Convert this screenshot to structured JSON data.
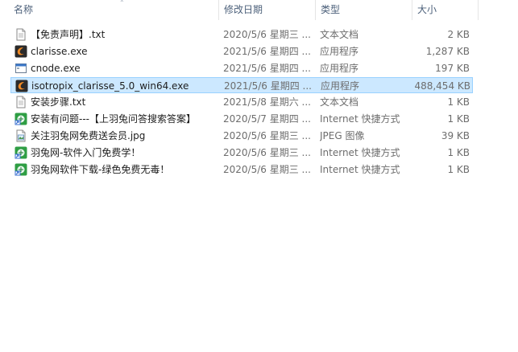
{
  "columns": {
    "name": "名称",
    "date": "修改日期",
    "type": "类型",
    "size": "大小"
  },
  "files": [
    {
      "name": "【免责声明】.txt",
      "date": "2020/5/6 星期三 ...",
      "type": "文本文档",
      "size": "2 KB",
      "icon": "text-file-icon"
    },
    {
      "name": "clarisse.exe",
      "date": "2021/5/6 星期四 ...",
      "type": "应用程序",
      "size": "1,287 KB",
      "icon": "clarisse-app-icon"
    },
    {
      "name": "cnode.exe",
      "date": "2021/5/6 星期四 ...",
      "type": "应用程序",
      "size": "197 KB",
      "icon": "exe-window-icon"
    },
    {
      "name": "isotropix_clarisse_5.0_win64.exe",
      "date": "2021/5/6 星期四 ...",
      "type": "应用程序",
      "size": "488,454 KB",
      "icon": "clarisse-app-icon",
      "selected": true
    },
    {
      "name": "安装步骤.txt",
      "date": "2021/5/8 星期六 ...",
      "type": "文本文档",
      "size": "1 KB",
      "icon": "text-file-icon"
    },
    {
      "name": "安装有问题---【上羽兔问答搜索答案】",
      "date": "2020/5/7 星期四 ...",
      "type": "Internet 快捷方式",
      "size": "1 KB",
      "icon": "internet-shortcut-icon"
    },
    {
      "name": "关注羽兔网免费送会员.jpg",
      "date": "2020/5/6 星期三 ...",
      "type": "JPEG 图像",
      "size": "39 KB",
      "icon": "image-file-icon"
    },
    {
      "name": "羽兔网-软件入门免费学！",
      "date": "2020/5/6 星期三 ...",
      "type": "Internet 快捷方式",
      "size": "1 KB",
      "icon": "internet-shortcut-icon"
    },
    {
      "name": "羽兔网软件下载-绿色免费无毒！",
      "date": "2020/5/6 星期三 ...",
      "type": "Internet 快捷方式",
      "size": "1 KB",
      "icon": "internet-shortcut-icon"
    }
  ],
  "colors": {
    "selection_fill": "#cce8ff",
    "selection_border": "#99d1ff",
    "header_text": "#4c607a"
  }
}
